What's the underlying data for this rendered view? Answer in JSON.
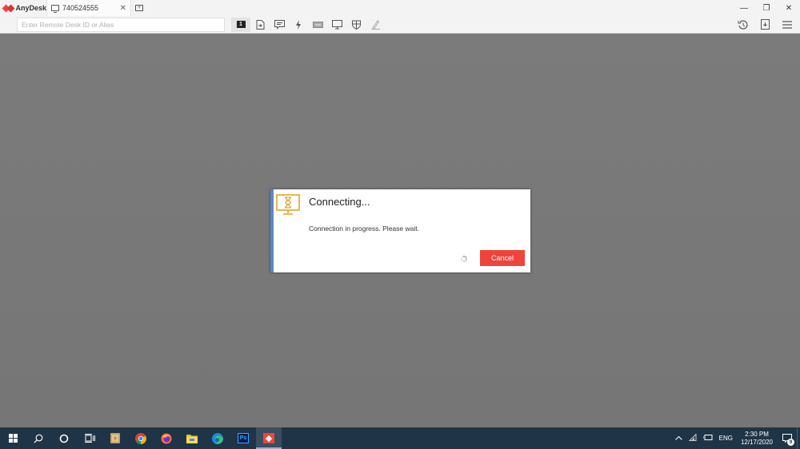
{
  "app": {
    "name": "AnyDesk",
    "brand_color": "#ef443b"
  },
  "tabs": [
    {
      "label": "740524555",
      "icon": "monitor-icon",
      "close_label": "✕"
    }
  ],
  "new_tab_icon": "add-session-icon",
  "window_controls": {
    "minimize": "—",
    "restore": "❐",
    "close": "✕"
  },
  "toolbar": {
    "search_placeholder": "Enter Remote Desk ID or Alias",
    "monitor_badge": "1",
    "tools": [
      "monitor-select-icon",
      "file-transfer-icon",
      "chat-icon",
      "actions-icon",
      "keyboard-icon",
      "display-icon",
      "permissions-icon",
      "whiteboard-icon"
    ],
    "right_tools": [
      "history-icon",
      "download-icon",
      "menu-icon"
    ]
  },
  "dialog": {
    "title": "Connecting...",
    "message": "Connection in progress. Please wait.",
    "cancel_label": "Cancel",
    "accent_color": "#5b87c6",
    "icon_color": "#e0a42a"
  },
  "taskbar": {
    "apps": [
      "start",
      "search",
      "cortana",
      "task-view",
      "media-player",
      "chrome",
      "firefox",
      "file-explorer",
      "edge",
      "photoshop",
      "anydesk"
    ],
    "photoshop_label": "Ps",
    "tray": {
      "language": "ENG",
      "time": "2:30 PM",
      "date": "12/17/2020",
      "notification_count": "9"
    }
  }
}
